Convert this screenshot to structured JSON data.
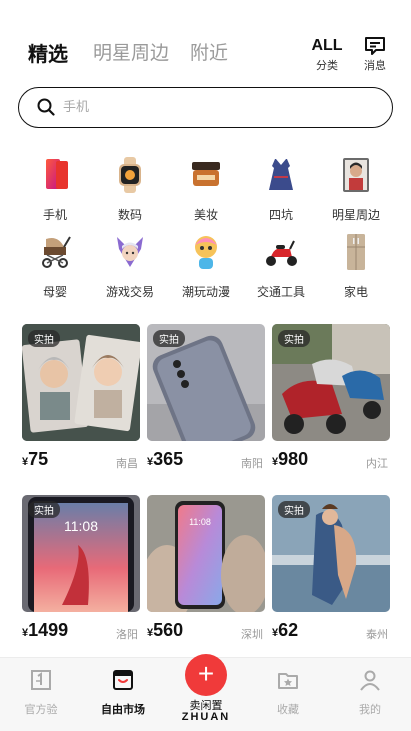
{
  "header": {
    "tabs": [
      {
        "label": "精选",
        "active": true
      },
      {
        "label": "明星周边",
        "active": false
      },
      {
        "label": "附近",
        "active": false
      }
    ],
    "all_top": "ALL",
    "all_label": "分类",
    "msg_label": "消息"
  },
  "search": {
    "placeholder": "手机"
  },
  "categories": [
    {
      "label": "手机",
      "icon": "phone-icon"
    },
    {
      "label": "数码",
      "icon": "watch-icon"
    },
    {
      "label": "美妆",
      "icon": "cosmetics-icon"
    },
    {
      "label": "四坑",
      "icon": "dress-icon"
    },
    {
      "label": "明星周边",
      "icon": "star-photo-icon"
    },
    {
      "label": "母婴",
      "icon": "stroller-icon"
    },
    {
      "label": "游戏交易",
      "icon": "game-character-icon"
    },
    {
      "label": "潮玩动漫",
      "icon": "toy-figure-icon"
    },
    {
      "label": "交通工具",
      "icon": "scooter-icon"
    },
    {
      "label": "家电",
      "icon": "fridge-icon"
    }
  ],
  "products": [
    {
      "tag": "实拍",
      "currency": "¥",
      "price": "75",
      "city": "南昌",
      "image": "photo-cards"
    },
    {
      "tag": "实拍",
      "currency": "¥",
      "price": "365",
      "city": "南阳",
      "image": "phone-back"
    },
    {
      "tag": "实拍",
      "currency": "¥",
      "price": "980",
      "city": "内江",
      "image": "scooters"
    },
    {
      "tag": "实拍",
      "currency": "¥",
      "price": "1499",
      "city": "洛阳",
      "image": "tablet"
    },
    {
      "tag": "",
      "currency": "¥",
      "price": "560",
      "city": "深圳",
      "image": "phone-front"
    },
    {
      "tag": "实拍",
      "currency": "¥",
      "price": "62",
      "city": "泰州",
      "image": "painting"
    }
  ],
  "bottom_nav": {
    "items": [
      {
        "label": "官方验",
        "icon": "verify-icon"
      },
      {
        "label": "自由市场",
        "icon": "market-icon",
        "active": true
      },
      {
        "label": "收藏",
        "icon": "favorite-folder-icon"
      },
      {
        "label": "我的",
        "icon": "profile-icon"
      }
    ],
    "sell_label": "卖闲置",
    "brand": "ZHUAN",
    "accent": "#f03a3a"
  }
}
